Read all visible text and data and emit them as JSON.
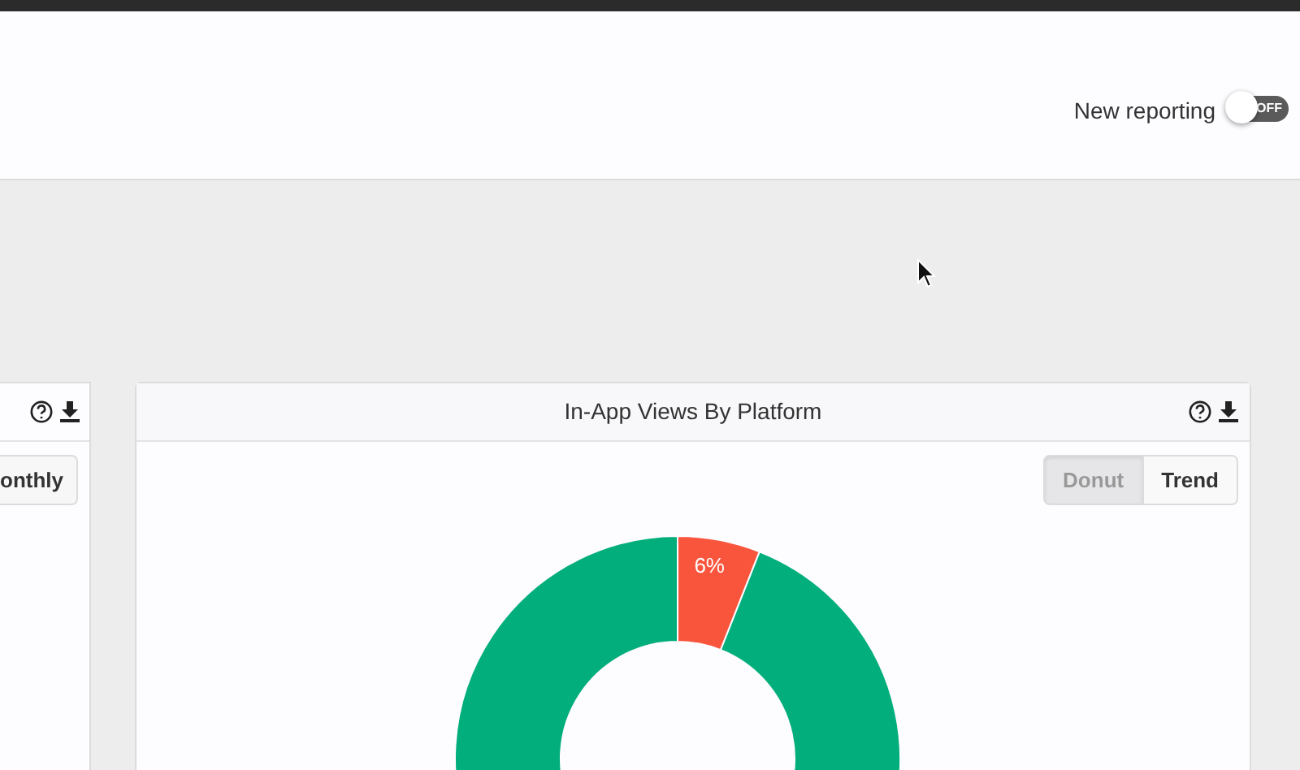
{
  "header": {
    "toggle_label": "New reporting",
    "toggle": {
      "on": false,
      "text": "OFF"
    }
  },
  "left_card": {
    "button": "onthly"
  },
  "card": {
    "title": "In-App Views By Platform",
    "view_buttons": [
      {
        "label": "Donut",
        "selected": true
      },
      {
        "label": "Trend",
        "selected": false
      }
    ],
    "chart_data": {
      "type": "donut",
      "values": [
        6,
        94
      ],
      "colors": [
        "#f9553d",
        "#02ae7c"
      ],
      "value_labels": [
        "6%",
        null
      ]
    }
  }
}
